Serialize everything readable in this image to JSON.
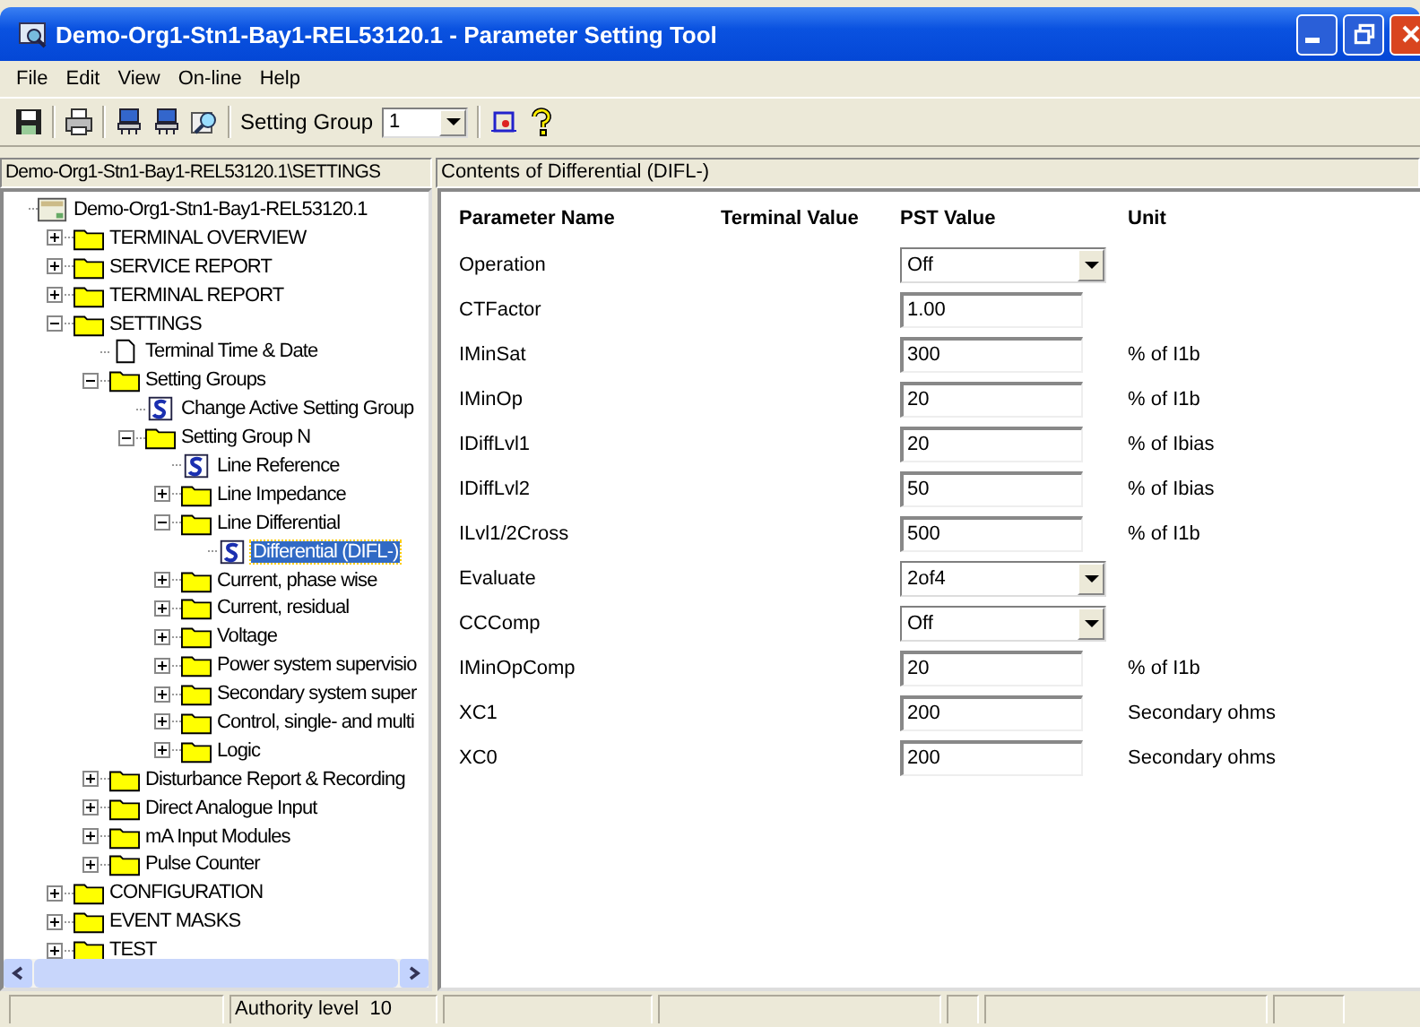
{
  "window": {
    "title": "Demo-Org1-Stn1-Bay1-REL53120.1 - Parameter Setting Tool"
  },
  "menu": [
    "File",
    "Edit",
    "View",
    "On-line",
    "Help"
  ],
  "toolbar": {
    "setting_group_label": "Setting Group",
    "setting_group_value": "1"
  },
  "path_bar": {
    "left": "Demo-Org1-Stn1-Bay1-REL53120.1\\SETTINGS",
    "right": "Contents of Differential (DIFL-)"
  },
  "tree": [
    {
      "label": "Demo-Org1-Stn1-Bay1-REL53120.1",
      "kind": "root",
      "selected": false,
      "children": [
        {
          "label": "TERMINAL OVERVIEW",
          "kind": "folder",
          "expanded": false,
          "selected": false
        },
        {
          "label": "SERVICE REPORT",
          "kind": "folder",
          "expanded": false,
          "selected": false
        },
        {
          "label": "TERMINAL REPORT",
          "kind": "folder",
          "expanded": false,
          "selected": false
        },
        {
          "label": "SETTINGS",
          "kind": "folder",
          "expanded": true,
          "selected": false,
          "children": [
            {
              "label": "Terminal Time & Date",
              "kind": "page",
              "selected": false
            },
            {
              "label": "Setting Groups",
              "kind": "folder",
              "expanded": true,
              "selected": false,
              "children": [
                {
                  "label": "Change Active Setting Group",
                  "kind": "script",
                  "selected": false
                },
                {
                  "label": "Setting Group N",
                  "kind": "folder",
                  "expanded": true,
                  "selected": false,
                  "children": [
                    {
                      "label": "Line Reference",
                      "kind": "script",
                      "selected": false
                    },
                    {
                      "label": "Line Impedance",
                      "kind": "folder",
                      "expanded": false,
                      "selected": false
                    },
                    {
                      "label": "Line Differential",
                      "kind": "folder",
                      "expanded": true,
                      "selected": false,
                      "children": [
                        {
                          "label": "Differential (DIFL-)",
                          "kind": "script",
                          "selected": true
                        }
                      ]
                    },
                    {
                      "label": "Current, phase wise",
                      "kind": "folder",
                      "expanded": false,
                      "selected": false
                    },
                    {
                      "label": "Current, residual",
                      "kind": "folder",
                      "expanded": false,
                      "selected": false
                    },
                    {
                      "label": "Voltage",
                      "kind": "folder",
                      "expanded": false,
                      "selected": false
                    },
                    {
                      "label": "Power system supervisio",
                      "kind": "folder",
                      "expanded": false,
                      "selected": false
                    },
                    {
                      "label": "Secondary system super",
                      "kind": "folder",
                      "expanded": false,
                      "selected": false
                    },
                    {
                      "label": "Control, single- and multi",
                      "kind": "folder",
                      "expanded": false,
                      "selected": false
                    },
                    {
                      "label": "Logic",
                      "kind": "folder",
                      "expanded": false,
                      "selected": false
                    }
                  ]
                }
              ]
            },
            {
              "label": "Disturbance Report & Recording",
              "kind": "folder",
              "expanded": false,
              "selected": false
            },
            {
              "label": "Direct Analogue Input",
              "kind": "folder",
              "expanded": false,
              "selected": false
            },
            {
              "label": "mA Input Modules",
              "kind": "folder",
              "expanded": false,
              "selected": false
            },
            {
              "label": "Pulse Counter",
              "kind": "folder",
              "expanded": false,
              "selected": false
            }
          ]
        },
        {
          "label": "CONFIGURATION",
          "kind": "folder",
          "expanded": false,
          "selected": false
        },
        {
          "label": "EVENT MASKS",
          "kind": "folder",
          "expanded": false,
          "selected": false
        },
        {
          "label": "TEST",
          "kind": "folder",
          "expanded": false,
          "selected": false
        }
      ]
    }
  ],
  "table": {
    "columns": [
      "Parameter Name",
      "Terminal Value",
      "PST Value",
      "Unit"
    ],
    "rows": [
      {
        "name": "Operation",
        "kind": "combo",
        "value": "Off"
      },
      {
        "name": "CTFactor",
        "kind": "text",
        "value": "1.00"
      },
      {
        "name": "IMinSat",
        "kind": "text",
        "value": "300",
        "unit": "% of I1b"
      },
      {
        "name": "IMinOp",
        "kind": "text",
        "value": "20",
        "unit": "% of I1b"
      },
      {
        "name": "IDiffLvl1",
        "kind": "text",
        "value": "20",
        "unit": "% of Ibias"
      },
      {
        "name": "IDiffLvl2",
        "kind": "text",
        "value": "50",
        "unit": "% of Ibias"
      },
      {
        "name": "ILvl1/2Cross",
        "kind": "text",
        "value": "500",
        "unit": "% of I1b"
      },
      {
        "name": "Evaluate",
        "kind": "combo",
        "value": "2of4"
      },
      {
        "name": "CCComp",
        "kind": "combo",
        "value": "Off"
      },
      {
        "name": "IMinOpComp",
        "kind": "text",
        "value": "20",
        "unit": "% of I1b"
      },
      {
        "name": "XC1",
        "kind": "text",
        "value": "200",
        "unit": "Secondary ohms"
      },
      {
        "name": "XC0",
        "kind": "text",
        "value": "200",
        "unit": "Secondary ohms"
      }
    ]
  },
  "status_bar": {
    "authority": "Authority level  10"
  }
}
